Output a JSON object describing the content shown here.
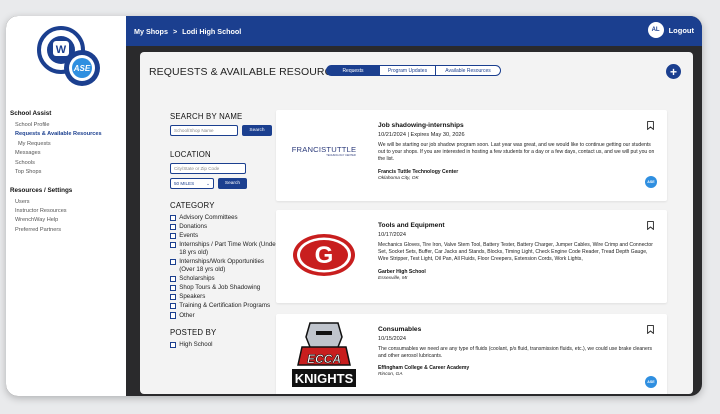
{
  "topbar": {
    "crumb_root": "My Shops",
    "crumb_sep": ">",
    "crumb_current": "Lodi High School",
    "avatar_initials": "AL",
    "logout_label": "Logout"
  },
  "logo": {
    "w_text": "W",
    "ase_text": "ASE"
  },
  "sidebar": {
    "section1_title": "School Assist",
    "section1_items": [
      "School Profile",
      "Requests & Available Resources",
      "My Requests",
      "Messages",
      "Schools",
      "Top Shops"
    ],
    "active_item": "Requests & Available Resources",
    "section2_title": "Resources / Settings",
    "section2_items": [
      "Users",
      "Instructor Resources",
      "WrenchWay Help",
      "Preferred Partners"
    ]
  },
  "page": {
    "title": "REQUESTS & AVAILABLE RESOURCES",
    "tabs": [
      "Requests",
      "Program Updates",
      "Available Resources"
    ],
    "active_tab": "Requests",
    "add_symbol": "+"
  },
  "filters": {
    "search_heading": "SEARCH BY NAME",
    "search_placeholder": "School/Shop Name",
    "search_button": "Search",
    "location_heading": "LOCATION",
    "location_placeholder": "City/State or Zip Code",
    "distance_value": "50 MILES",
    "location_button": "Search",
    "category_heading": "CATEGORY",
    "categories": [
      "Advisory Committees",
      "Donations",
      "Events",
      "Internships / Part Time Work (Under 18 yrs old)",
      "Internships/Work Opportunities (Over 18 yrs old)",
      "Scholarships",
      "Shop Tours & Job Shadowing",
      "Speakers",
      "Training & Certification Programs",
      "Other"
    ],
    "posted_heading": "POSTED BY",
    "posted_options": [
      "High School"
    ]
  },
  "cards": [
    {
      "title": "Job shadowing-internships",
      "date": "10/21/2024 | Expires May 30, 2026",
      "text": "We will be starting our job shadow program soon. Last year was great, and we would like to continue getting our students out to your shops. If you are interested in hosting a few students for a day or a few days, contact us, and we will put you on the list.",
      "org": "Francis Tuttle Technology Center",
      "location": "Oklahoma City, OK",
      "logo_main": "FRANCISTUTTLE",
      "logo_sub": "TECHNOLOGY CENTER",
      "badge": "ASE"
    },
    {
      "title": "Tools and Equipment",
      "date": "10/17/2024",
      "text": "Mechanics Gloves, Tire Iron, Valve Stem Tool, Battery Tester, Battery Charger, Jumper Cables, Wire Crimp and Connector Set, Socket Sets, Buffer, Car Jacks and Stands, Blocks, Timing Light, Check Engine Code Reader, Tread Depth Gauge, Wire Stripper, Test Light, Oil Pan, All Fluids, Floor Creepers, Extension Cords, Work Lights,",
      "org": "Garber High School",
      "location": "Essexville, MI",
      "logo_letter": "G"
    },
    {
      "title": "Consumables",
      "date": "10/15/2024",
      "text": "The consumables we need are any type of fluids (coolant, p/s fluid, transmission fluids, etc.), we could use brake cleaners and other aerosol lubricants.",
      "org": "Effingham College & Career Academy",
      "location": "Rincon, GA",
      "logo_top": "ECCA",
      "logo_bottom": "KNIGHTS",
      "badge": "ASE"
    }
  ]
}
